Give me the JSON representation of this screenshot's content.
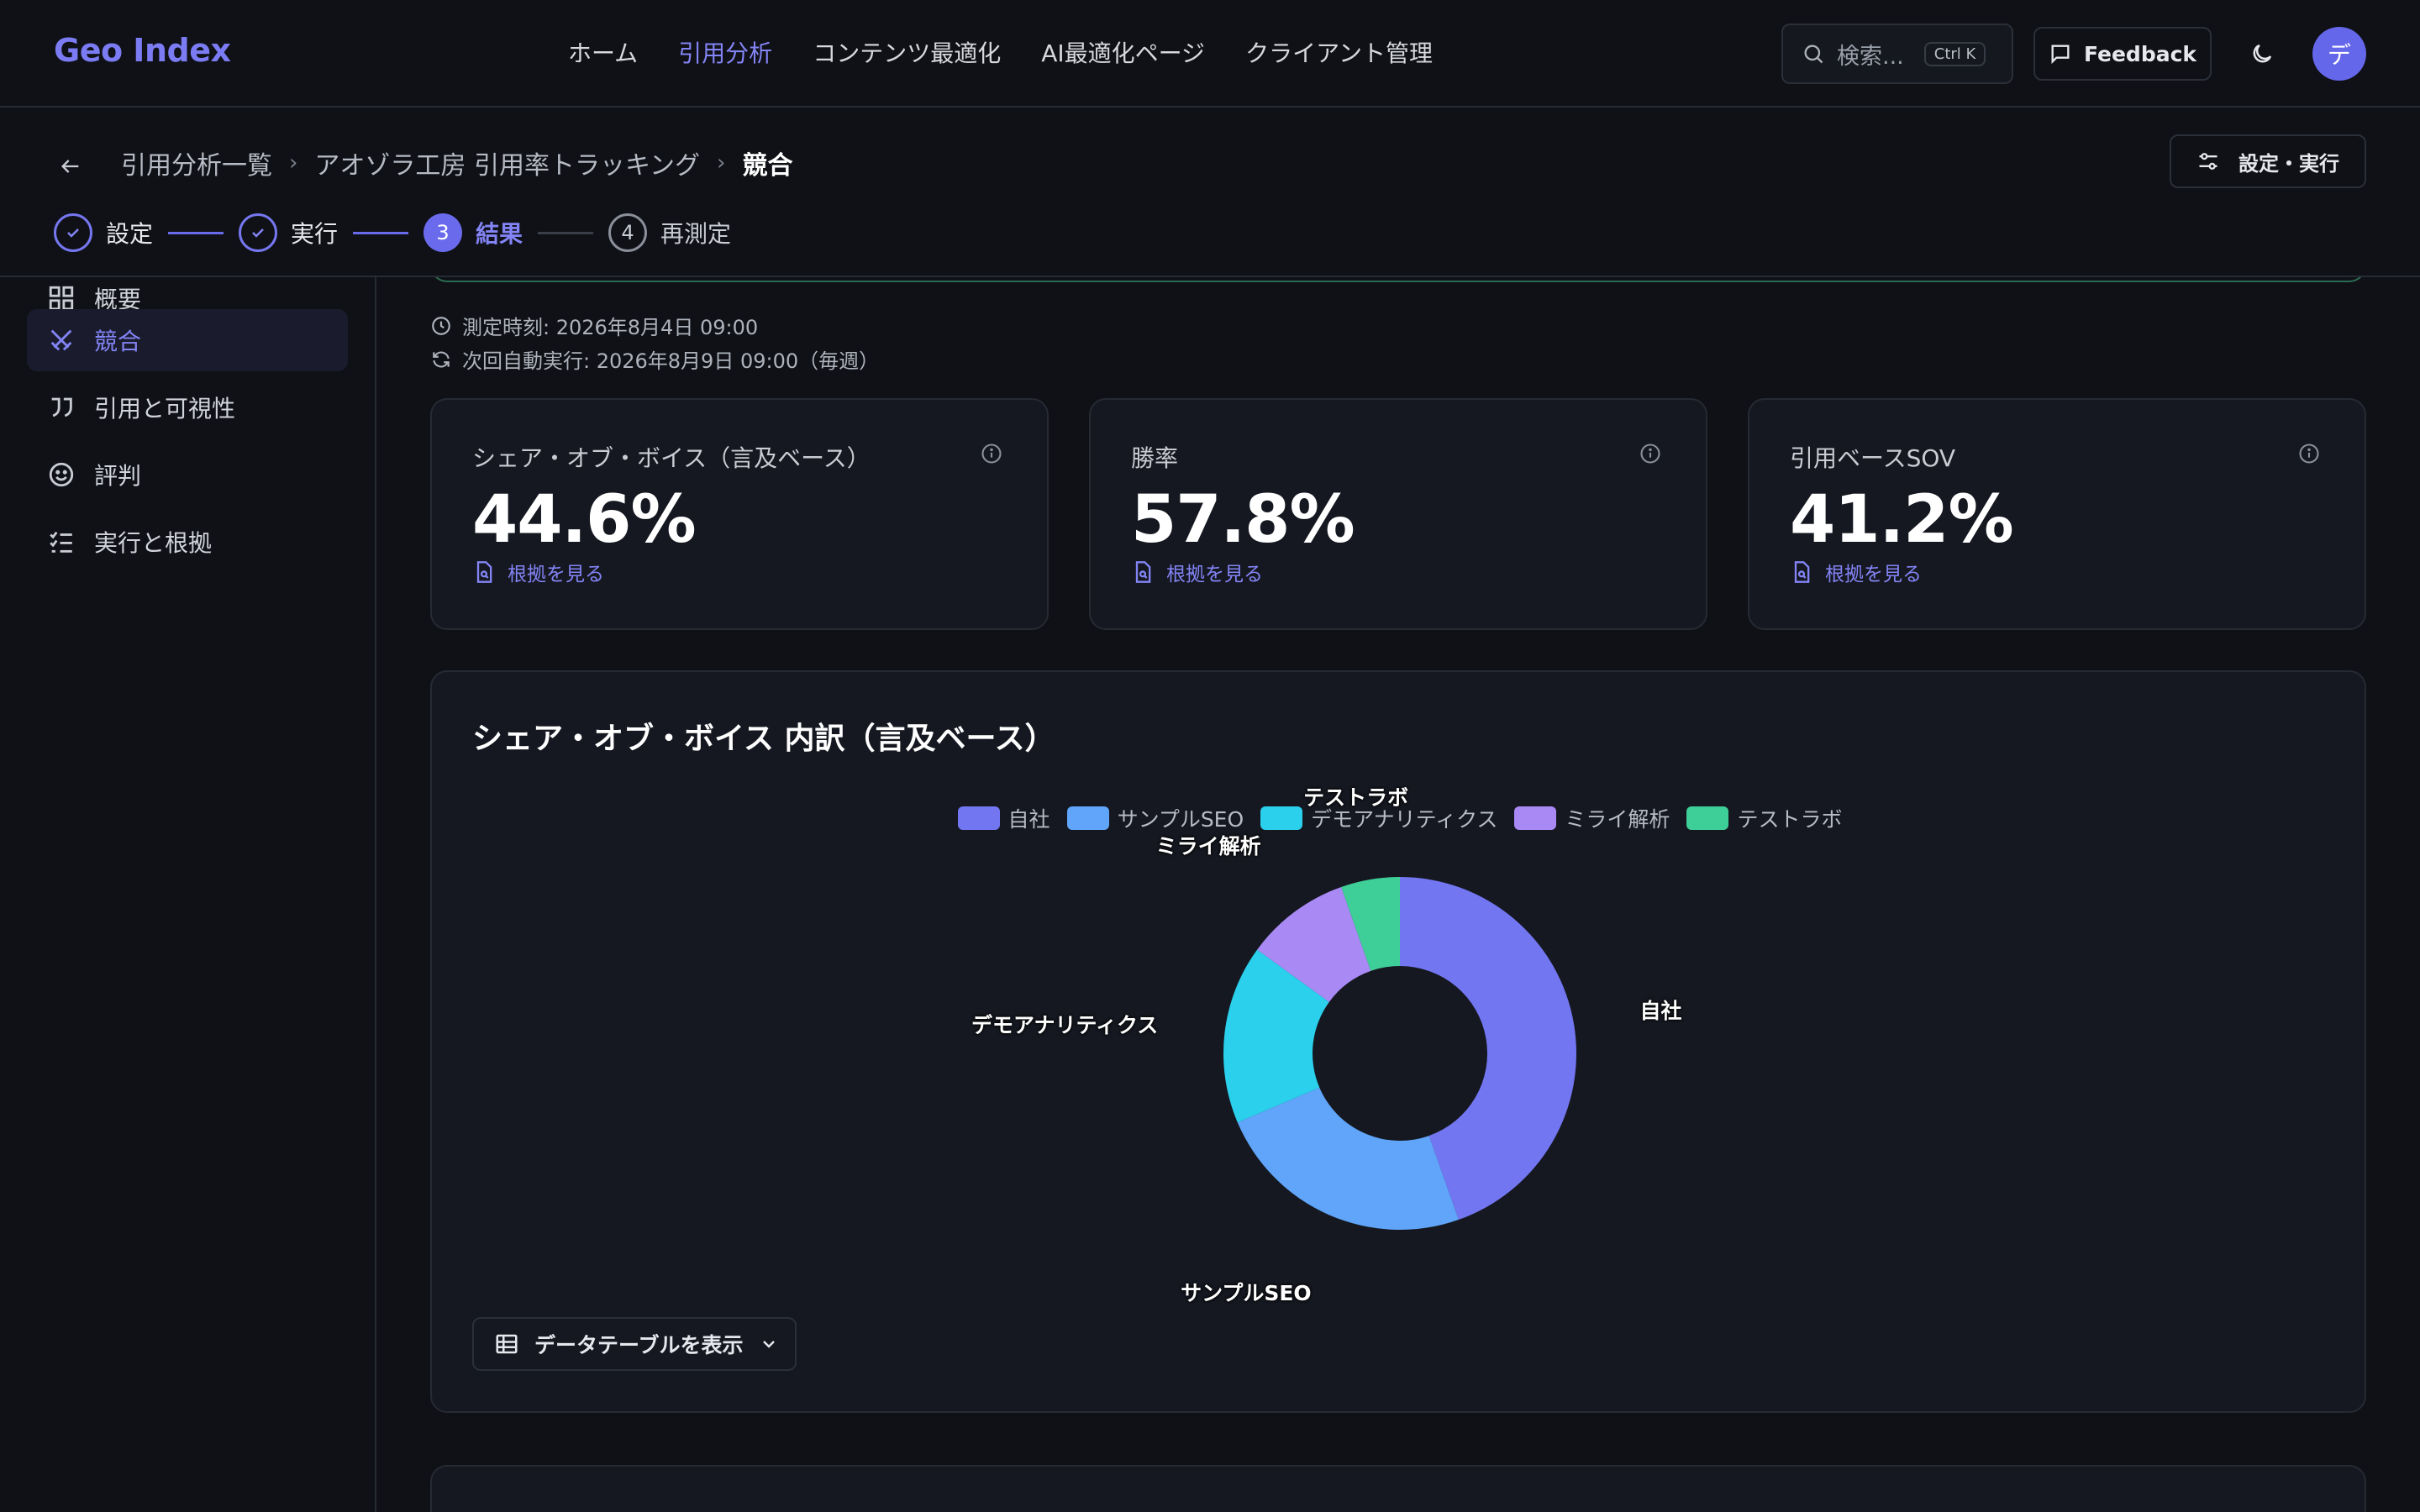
{
  "app": {
    "name": "Geo Index"
  },
  "nav": {
    "items": [
      "ホーム",
      "引用分析",
      "コンテンツ最適化",
      "AI最適化ページ",
      "クライアント管理"
    ],
    "active_index": 1
  },
  "search": {
    "placeholder": "検索...",
    "shortcut": "Ctrl K"
  },
  "header_actions": {
    "feedback": "Feedback",
    "avatar_initial": "デ"
  },
  "breadcrumb": {
    "items": [
      "引用分析一覧",
      "アオゾラ工房 引用率トラッキング"
    ],
    "current": "競合"
  },
  "settings_run_label": "設定・実行",
  "stepper": [
    {
      "label": "設定",
      "state": "done"
    },
    {
      "label": "実行",
      "state": "done"
    },
    {
      "label": "結果",
      "state": "current",
      "number": "3"
    },
    {
      "label": "再測定",
      "state": "todo",
      "number": "4"
    }
  ],
  "sidebar": {
    "items": [
      {
        "label": "概要",
        "icon": "grid-icon"
      },
      {
        "label": "競合",
        "icon": "swords-icon",
        "active": true
      },
      {
        "label": "引用と可視性",
        "icon": "quote-icon"
      },
      {
        "label": "評判",
        "icon": "smile-icon"
      },
      {
        "label": "実行と根拠",
        "icon": "checklist-icon"
      }
    ]
  },
  "meta": {
    "measured_at": "測定時刻: 2026年8月4日 09:00",
    "next_run": "次回自動実行: 2026年8月9日 09:00（毎週）"
  },
  "kpis": [
    {
      "title": "シェア・オブ・ボイス（言及ベース）",
      "value": "44.6%",
      "link": "根拠を見る"
    },
    {
      "title": "勝率",
      "value": "57.8%",
      "link": "根拠を見る"
    },
    {
      "title": "引用ベースSOV",
      "value": "41.2%",
      "link": "根拠を見る"
    }
  ],
  "chart_section": {
    "title": "シェア・オブ・ボイス 内訳（言及ベース）",
    "table_button": "データテーブルを表示"
  },
  "chart_data": {
    "type": "pie",
    "title": "シェア・オブ・ボイス 内訳（言及ベース）",
    "donut": true,
    "legend_position": "top",
    "categories": [
      "自社",
      "サンプルSEO",
      "デモアナリティクス",
      "ミライ解析",
      "テストラボ"
    ],
    "values": [
      44.6,
      24.0,
      16.4,
      9.6,
      5.4
    ],
    "colors": [
      "#7376f1",
      "#60a5fa",
      "#2ad0ec",
      "#a98af5",
      "#3ecf98"
    ]
  }
}
